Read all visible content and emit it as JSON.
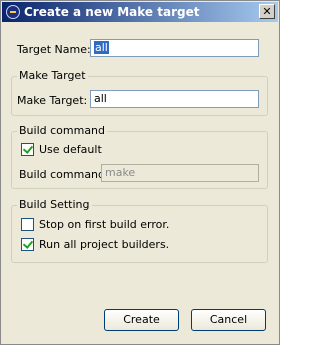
{
  "window": {
    "title": "Create a new Make target"
  },
  "target_name": {
    "label": "Target Name:",
    "value": "all"
  },
  "make_target": {
    "group_title": "Make Target",
    "label": "Make Target:",
    "value": "all"
  },
  "build_command": {
    "group_title": "Build command",
    "use_default_label": "Use default",
    "use_default_checked": true,
    "label": "Build command:",
    "value": "make"
  },
  "build_setting": {
    "group_title": "Build Setting",
    "stop_label": "Stop on first build error.",
    "stop_checked": false,
    "run_all_label": "Run all project builders.",
    "run_all_checked": true
  },
  "buttons": {
    "create": "Create",
    "cancel": "Cancel"
  }
}
